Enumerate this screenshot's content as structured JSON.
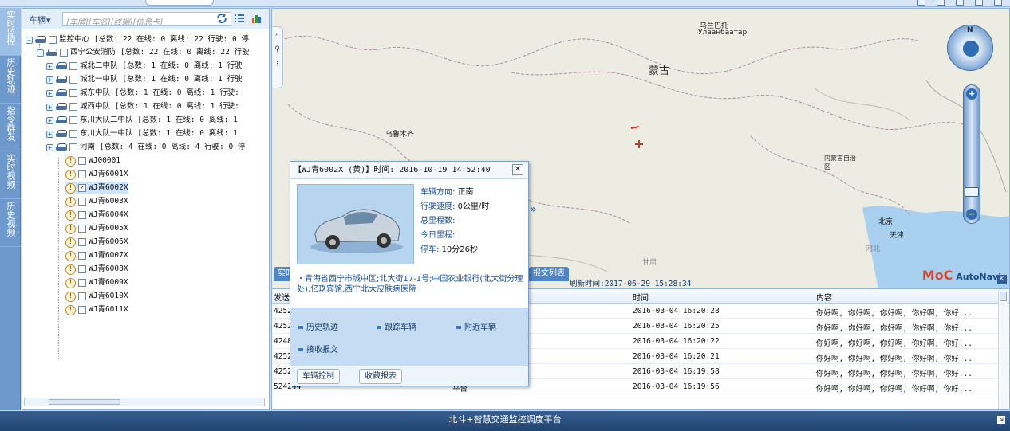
{
  "sidebar_tabs": [
    "实时监控",
    "历史轨迹",
    "指令群发",
    "实时视频",
    "历史视频"
  ],
  "tree": {
    "vehicle_select": "车辆▾",
    "search_placeholder": "[车牌][车名][终端][信息卡]",
    "nodes": [
      {
        "label": "监控中心 [总数: 22 在线: 0 离线: 22 行驶: 0 停"
      },
      {
        "label": "西宁公安消防 [总数: 22 在线: 0 离线: 22 行驶"
      },
      {
        "label": "城北二中队 [总数: 1 在线: 0 离线: 1 行驶"
      },
      {
        "label": "城北一中队 [总数: 1 在线: 0 离线: 1 行驶"
      },
      {
        "label": "城东中队 [总数: 1 在线: 0 离线: 1 行驶:"
      },
      {
        "label": "城西中队 [总数: 1 在线: 0 离线: 1 行驶:"
      },
      {
        "label": "东川大队二中队 [总数: 1 在线: 0 离线: 1"
      },
      {
        "label": "东川大队一中队 [总数: 1 在线: 0 离线: 1"
      },
      {
        "label": "河南 [总数: 4 在线: 0 离线: 4 行驶: 0 停"
      },
      {
        "label": "WJ00001"
      },
      {
        "label": "WJ青6001X"
      },
      {
        "label": "WJ青6002X"
      },
      {
        "label": "WJ青6003X"
      },
      {
        "label": "WJ青6004X"
      },
      {
        "label": "WJ青6005X"
      },
      {
        "label": "WJ青6006X"
      },
      {
        "label": "WJ青6007X"
      },
      {
        "label": "WJ青6008X"
      },
      {
        "label": "WJ青6009X"
      },
      {
        "label": "WJ青6010X"
      },
      {
        "label": "WJ青6011X"
      }
    ]
  },
  "map": {
    "labels": [
      "乌兰巴托",
      "Улаанбаатар",
      "蒙古",
      "乌鲁木齐",
      "内蒙古自治区",
      "北京",
      "天津",
      "河北",
      "甘肃"
    ],
    "logo": "AutoNavi",
    "logo_mark": "MoC",
    "compass_n": "N"
  },
  "popup": {
    "title": "【WJ青6002X (黄)】时间: 2016-10-19 14:52:40",
    "info": [
      {
        "k": "车辆方向:",
        "v": "正南"
      },
      {
        "k": "行驶速度:",
        "v": "0公里/时"
      },
      {
        "k": "总里程数:",
        "v": ""
      },
      {
        "k": "今日里程:",
        "v": ""
      },
      {
        "k": "停车:",
        "v": "10分26秒"
      }
    ],
    "address": "・青海省西宁市城中区;北大街17-1号;中国农业银行(北大街分理处),亿玖宾馆,西宁北大皮肤病医院",
    "actions": [
      "历史轨迹",
      "跟踪车辆",
      "附近车辆",
      "接收报文"
    ],
    "tabs": [
      "车辆控制",
      "收藏报表"
    ]
  },
  "bottom": {
    "tab_left": "实时",
    "tab_right": "报文列表",
    "refresh": "刷新时间:2017-06-29 15:28:34",
    "headers": [
      "发送",
      "",
      "时间",
      "内容"
    ],
    "rows": [
      {
        "a": "4252",
        "b": "",
        "t": "2016-03-04 16:20:28",
        "c": "你好啊, 你好啊, 你好啊, 你好啊, 你好..."
      },
      {
        "a": "4252",
        "b": "",
        "t": "2016-03-04 16:20:25",
        "c": "你好啊, 你好啊, 你好啊, 你好啊, 你好..."
      },
      {
        "a": "4248",
        "b": "",
        "t": "2016-03-04 16:20:22",
        "c": "你好啊, 你好啊, 你好啊, 你好啊, 你好..."
      },
      {
        "a": "4252",
        "b": "",
        "t": "2016-03-04 16:20:21",
        "c": "你好啊, 你好啊, 你好啊, 你好啊, 你好..."
      },
      {
        "a": "4252",
        "b": "",
        "t": "2016-03-04 16:19:58",
        "c": "你好啊, 你好啊, 你好啊, 你好啊, 你好..."
      },
      {
        "a": "524244",
        "b": "平台",
        "t": "2016-03-04 16:19:56",
        "c": "你好啊, 你好啊, 你好啊, 你好啊, 你好..."
      }
    ]
  },
  "status_bar": "北斗+智慧交通监控调度平台"
}
